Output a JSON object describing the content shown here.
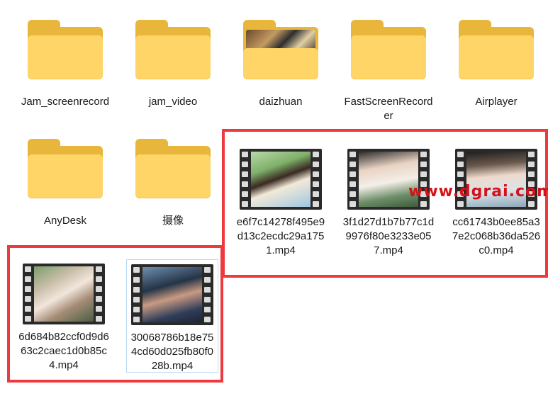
{
  "folders": [
    {
      "label": "Jam_screenrecord"
    },
    {
      "label": "jam_video"
    },
    {
      "label": "daizhuan"
    },
    {
      "label": "FastScreenRecorder"
    },
    {
      "label": "Airplayer"
    },
    {
      "label": "AnyDesk"
    },
    {
      "label": "摄像"
    }
  ],
  "videos": [
    {
      "label": "e6f7c14278f495e9d13c2ecdc29a1751.mp4"
    },
    {
      "label": "3f1d27d1b7b77c1d9976f80e3233e057.mp4"
    },
    {
      "label": "cc61743b0ee85a37e2c068b36da526c0.mp4"
    },
    {
      "label": "6d684b82ccf0d9d663c2caec1d0b85c4.mp4"
    },
    {
      "label": "30068786b18e754cd60d025fb80f028b.mp4"
    }
  ],
  "watermark": "www.dgrai.com",
  "colors": {
    "highlight": "#ee3a3e",
    "folder": "#ffd567"
  }
}
